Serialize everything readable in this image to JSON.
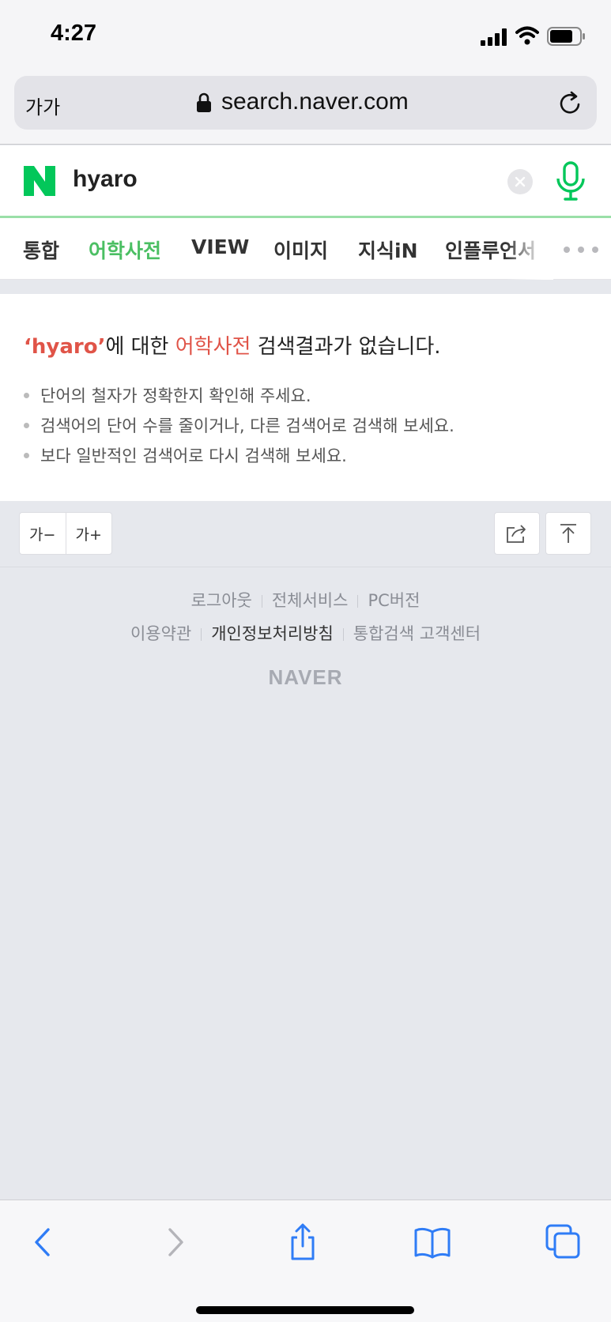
{
  "status_bar": {
    "time": "4:27"
  },
  "browser": {
    "text_size_label": "가가",
    "url": "search.naver.com"
  },
  "search": {
    "query": "hyaro"
  },
  "tabs": [
    {
      "label": "통합",
      "active": false
    },
    {
      "label": "어학사전",
      "active": true
    },
    {
      "label": "VIEW",
      "active": false
    },
    {
      "label": "이미지",
      "active": false
    },
    {
      "label": "지식iN",
      "active": false
    },
    {
      "label": "인플루언서",
      "active": false
    }
  ],
  "result": {
    "query_quoted": "‘hyaro’",
    "part_about": "에 대한 ",
    "category": "어학사전",
    "part_no_result": " 검색결과가 없습니다.",
    "tips": [
      "단어의 철자가 정확한지 확인해 주세요.",
      "검색어의 단어 수를 줄이거나, 다른 검색어로 검색해 보세요.",
      "보다 일반적인 검색어로 다시 검색해 보세요."
    ]
  },
  "tools": {
    "font_decrease": "가−",
    "font_increase": "가+"
  },
  "footer": {
    "row1": [
      "로그아웃",
      "전체서비스",
      "PC버전"
    ],
    "row2": [
      "이용약관",
      "개인정보처리방침",
      "통합검색 고객센터"
    ],
    "logo": "NAVER"
  },
  "colors": {
    "brand_green": "#03c75a",
    "active_tab": "#4bbf63",
    "highlight_red": "#e05448",
    "ios_blue": "#2f7cf6"
  }
}
